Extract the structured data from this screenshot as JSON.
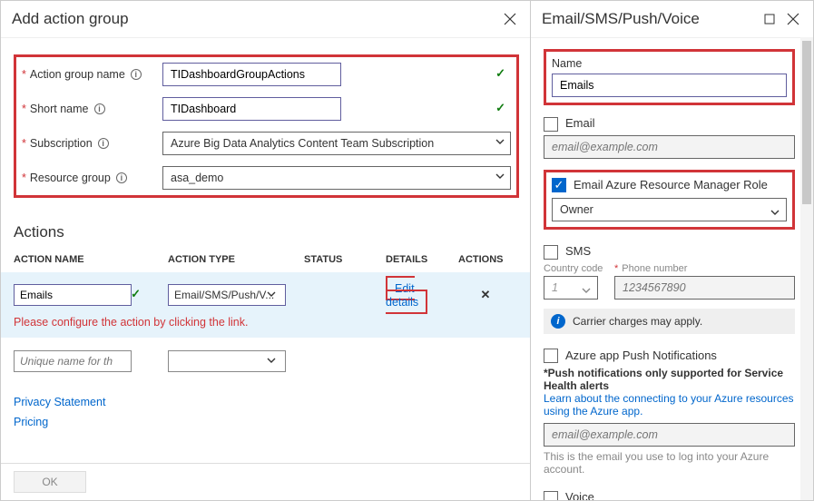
{
  "left": {
    "title": "Add action group",
    "fields": {
      "action_group_name_label": "Action group name",
      "action_group_name_value": "TIDashboardGroupActions",
      "short_name_label": "Short name",
      "short_name_value": "TIDashboard",
      "subscription_label": "Subscription",
      "subscription_value": "Azure Big Data Analytics Content Team Subscription",
      "resource_group_label": "Resource group",
      "resource_group_value": "asa_demo"
    },
    "actions_heading": "Actions",
    "columns": {
      "name": "ACTION NAME",
      "type": "ACTION TYPE",
      "status": "STATUS",
      "details": "DETAILS",
      "actions": "ACTIONS"
    },
    "row1": {
      "name": "Emails",
      "type": "Email/SMS/Push/V...",
      "edit": "Edit details",
      "warning": "Please configure the action by clicking the link."
    },
    "row2": {
      "name_placeholder": "Unique name for the act..."
    },
    "privacy": "Privacy Statement",
    "pricing": "Pricing",
    "ok": "OK"
  },
  "right": {
    "title": "Email/SMS/Push/Voice",
    "name_label": "Name",
    "name_value": "Emails",
    "email_label": "Email",
    "email_placeholder": "email@example.com",
    "arm_label": "Email Azure Resource Manager Role",
    "arm_value": "Owner",
    "sms_label": "SMS",
    "country_label": "Country code",
    "country_value": "1",
    "phone_label": "Phone number",
    "phone_placeholder": "1234567890",
    "carrier_msg": "Carrier charges may apply.",
    "push_label": "Azure app Push Notifications",
    "push_note": "*Push notifications only supported for Service Health alerts",
    "push_link": "Learn about the connecting to your Azure resources using the Azure app.",
    "push_email_placeholder": "email@example.com",
    "push_helper": "This is the email you use to log into your Azure account.",
    "voice_label": "Voice"
  }
}
